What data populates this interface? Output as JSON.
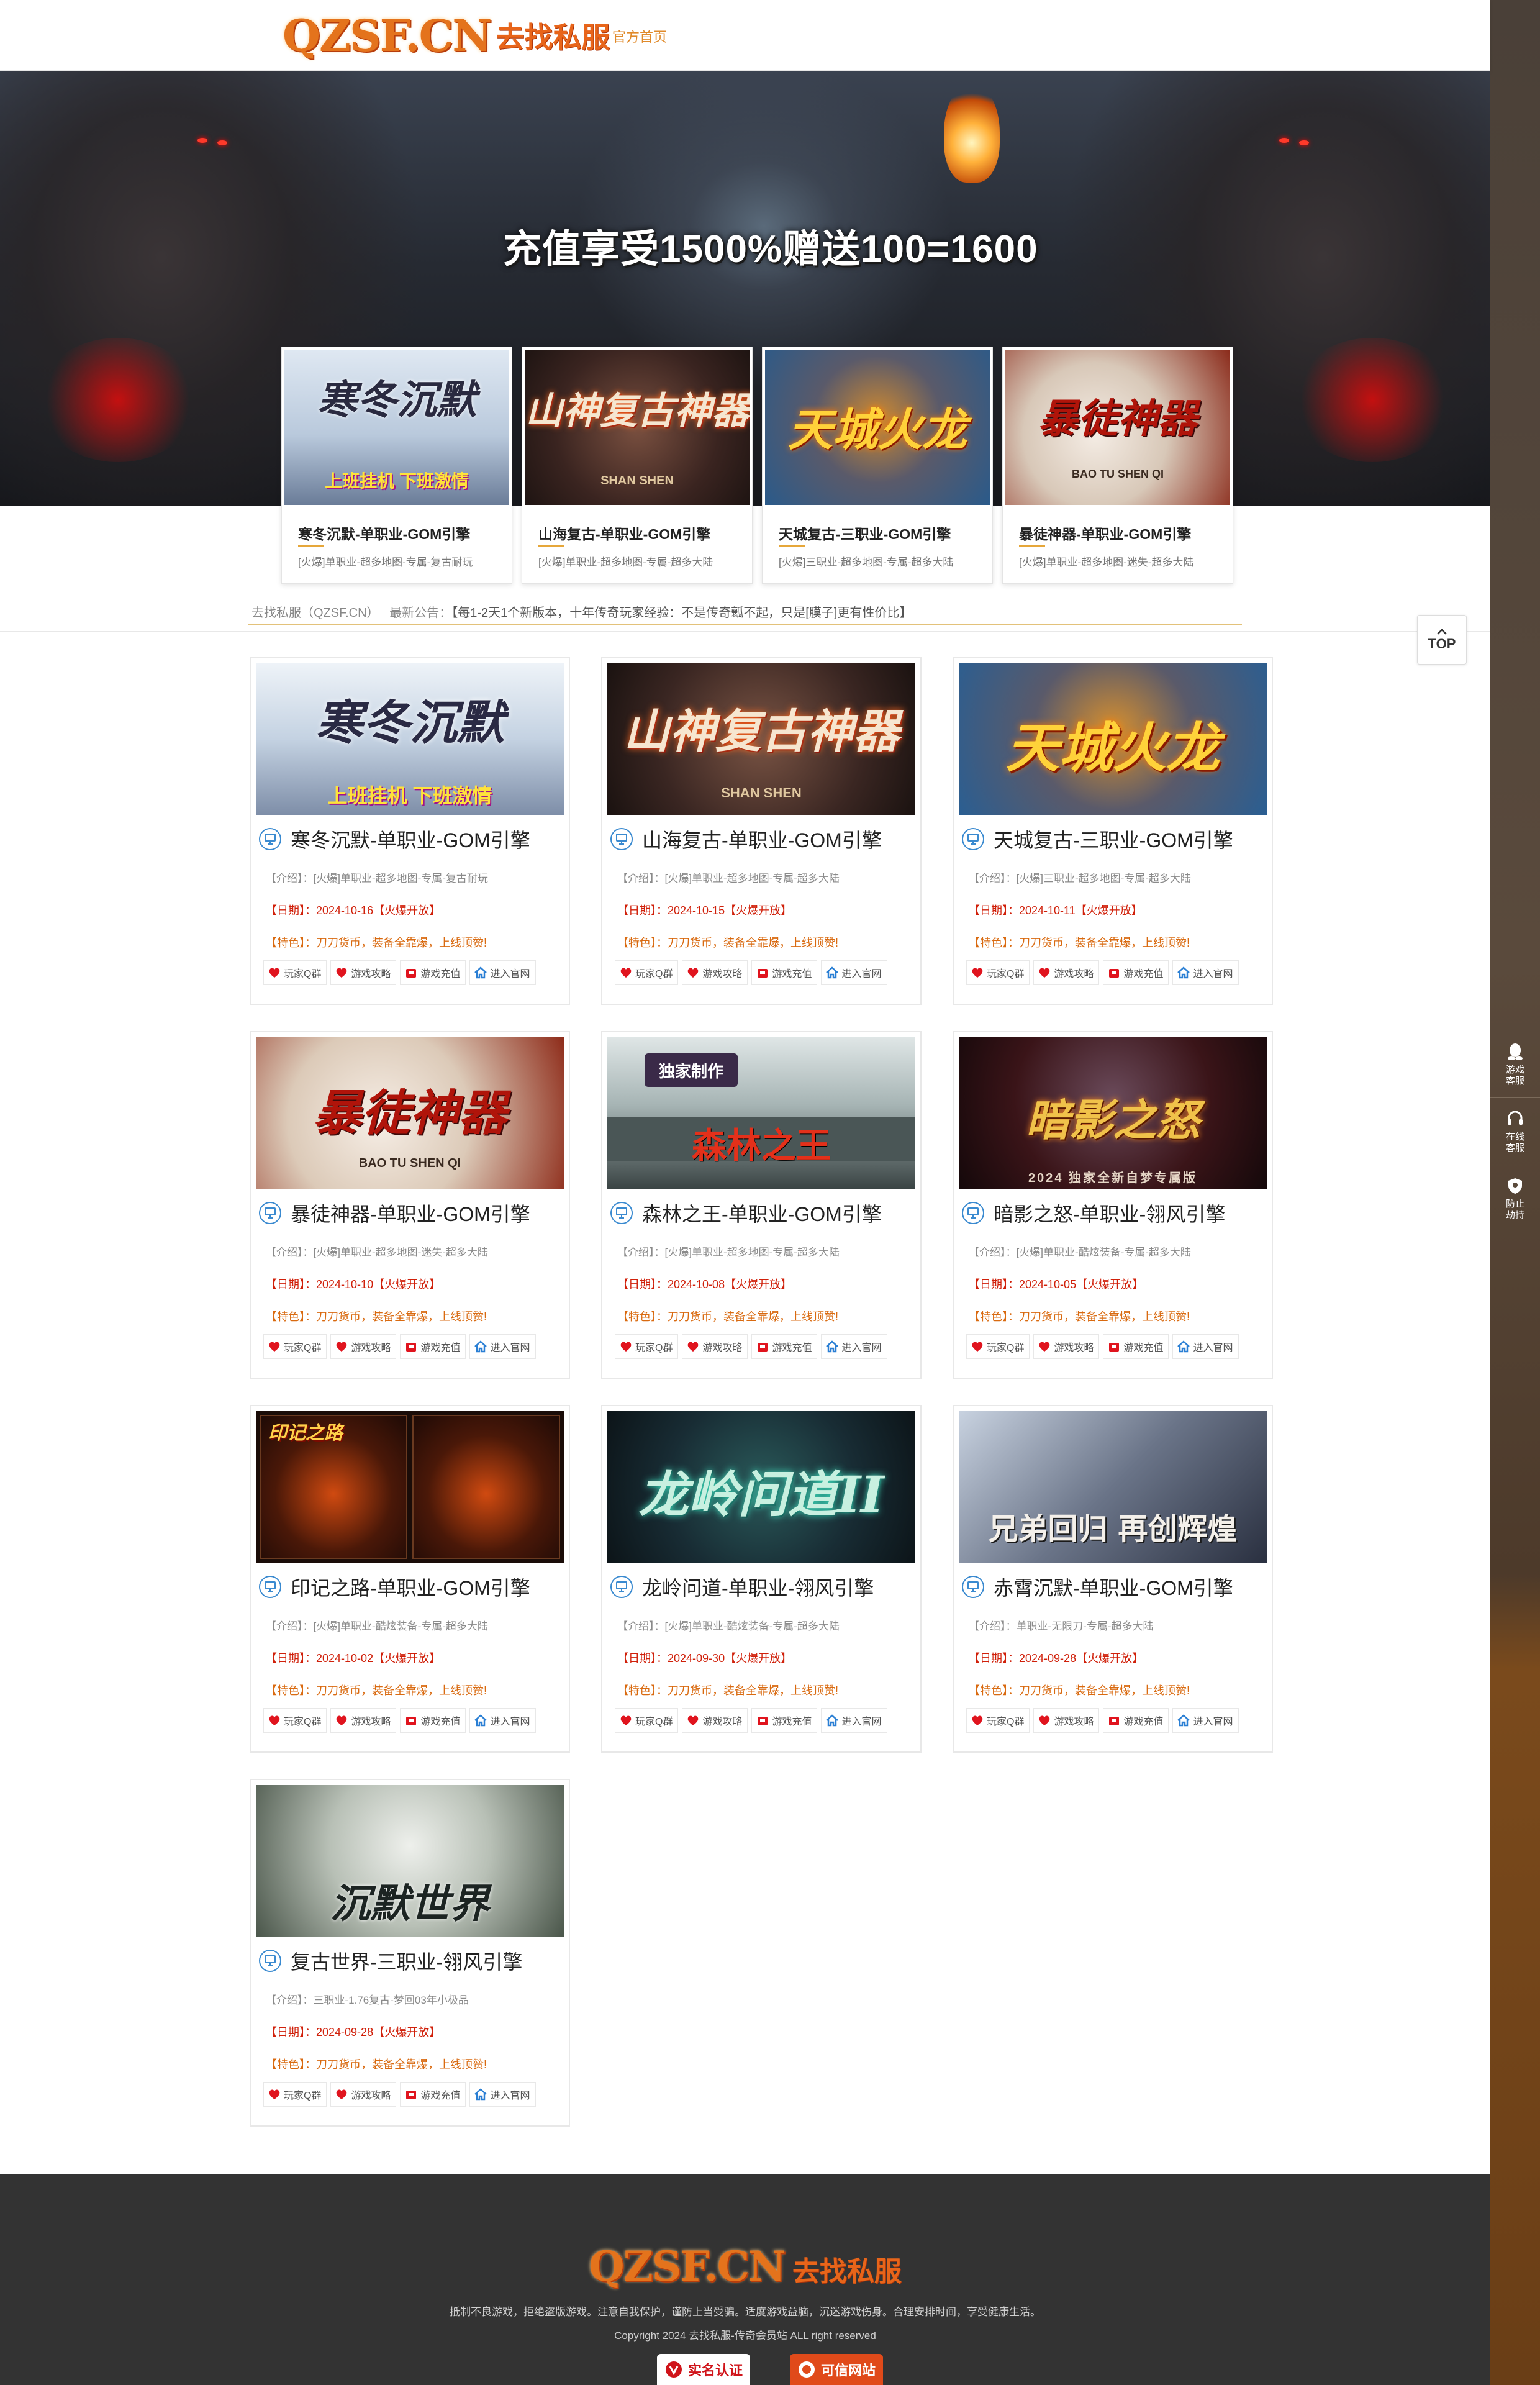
{
  "site": {
    "logo_en": "QZSF.CN",
    "logo_cn": "去找私服",
    "nav_home": "官方首页"
  },
  "banner": {
    "slogan": "充值享受1500%赠送100=1600"
  },
  "featured": [
    {
      "name": "寒冬沉默-单职业-GOM引擎",
      "desc": "[火爆]单职业-超多地图-专属-复古耐玩"
    },
    {
      "name": "山海复古-单职业-GOM引擎",
      "desc": "[火爆]单职业-超多地图-专属-超多大陆"
    },
    {
      "name": "天城复古-三职业-GOM引擎",
      "desc": "[火爆]三职业-超多地图-专属-超多大陆"
    },
    {
      "name": "暴徒神器-单职业-GOM引擎",
      "desc": "[火爆]单职业-超多地图-迷失-超多大陆"
    }
  ],
  "notice": {
    "site": "去找私服（QZSF.CN）",
    "label": "最新公告：",
    "text": "【每1-2天1个新版本，十年传奇玩家经验：不是传奇瓤不起，只是[膜子]更有性价比】"
  },
  "top_button": "TOP",
  "side_rail": [
    {
      "icon": "qq-icon",
      "label1": "游戏",
      "label2": "客服"
    },
    {
      "icon": "headset-icon",
      "label1": "在线",
      "label2": "客服"
    },
    {
      "icon": "shield-icon",
      "label1": "防止",
      "label2": "劫持"
    }
  ],
  "card_labels": {
    "intro": "【介绍】：",
    "date": "【日期】：",
    "feature": "【特色】：",
    "feature_text": "刀刀货币，装备全靠爆，上线顶赞!",
    "hot_tag": "【火爆开放】"
  },
  "card_buttons": [
    "玩家Q群",
    "游戏攻略",
    "游戏充值",
    "进入官网"
  ],
  "cards": [
    {
      "title": "寒冬沉默-单职业-GOM引擎",
      "intro": "[火爆]单职业-超多地图-专属-复古耐玩",
      "date": "2024-10-16",
      "art": "寒冬沉默",
      "art_sub": "上班挂机 下班激情"
    },
    {
      "title": "山海复古-单职业-GOM引擎",
      "intro": "[火爆]单职业-超多地图-专属-超多大陆",
      "date": "2024-10-15",
      "art": "山神复古神器",
      "art_sub": "SHAN SHEN"
    },
    {
      "title": "天城复古-三职业-GOM引擎",
      "intro": "[火爆]三职业-超多地图-专属-超多大陆",
      "date": "2024-10-11",
      "art": "天城火龙",
      "art_sub": ""
    },
    {
      "title": "暴徒神器-单职业-GOM引擎",
      "intro": "[火爆]单职业-超多地图-迷失-超多大陆",
      "date": "2024-10-10",
      "art": "暴徒神器",
      "art_sub": "BAO TU SHEN QI"
    },
    {
      "title": "森林之王-单职业-GOM引擎",
      "intro": "[火爆]单职业-超多地图-专属-超多大陆",
      "date": "2024-10-08",
      "art": "森林之王",
      "art_sub": "独家制作"
    },
    {
      "title": "暗影之怒-单职业-翎风引擎",
      "intro": "[火爆]单职业-酷炫装备-专属-超多大陆",
      "date": "2024-10-05",
      "art": "暗影之怒",
      "art_sub": "2024 独家全新自梦专属版"
    },
    {
      "title": "印记之路-单职业-GOM引擎",
      "intro": "[火爆]单职业-酷炫装备-专属-超多大陆",
      "date": "2024-10-02",
      "art": "印记之路",
      "art_sub": ""
    },
    {
      "title": "龙岭问道-单职业-翎风引擎",
      "intro": "[火爆]单职业-酷炫装备-专属-超多大陆",
      "date": "2024-09-30",
      "art": "龙岭问道II",
      "art_sub": ""
    },
    {
      "title": "赤霄沉默-单职业-GOM引擎",
      "intro": "单职业-无限刀-专属-超多大陆",
      "date": "2024-09-28",
      "art": "兄弟回归 再创辉煌",
      "art_sub": ""
    },
    {
      "title": "复古世界-三职业-翎风引擎",
      "intro": "三职业-1.76复古-梦回03年小极品",
      "date": "2024-09-28",
      "art": "沉默世界",
      "art_sub": ""
    }
  ],
  "footer": {
    "logo_en": "QZSF.CN",
    "logo_cn": "去找私服",
    "line1": "抵制不良游戏，拒绝盗版游戏。注意自我保护，谨防上当受骗。适度游戏益脑，沉迷游戏伤身。合理安排时间，享受健康生活。",
    "line2": "Copyright 2024 去找私服-传奇会员站 ALL right reserved",
    "badge1": "实名认证",
    "badge2": "可信网站"
  },
  "colors": {
    "accent": "#e4731c",
    "date_red": "#d0200a",
    "feature_orange": "#d96a10",
    "footer_bg": "#333333"
  }
}
